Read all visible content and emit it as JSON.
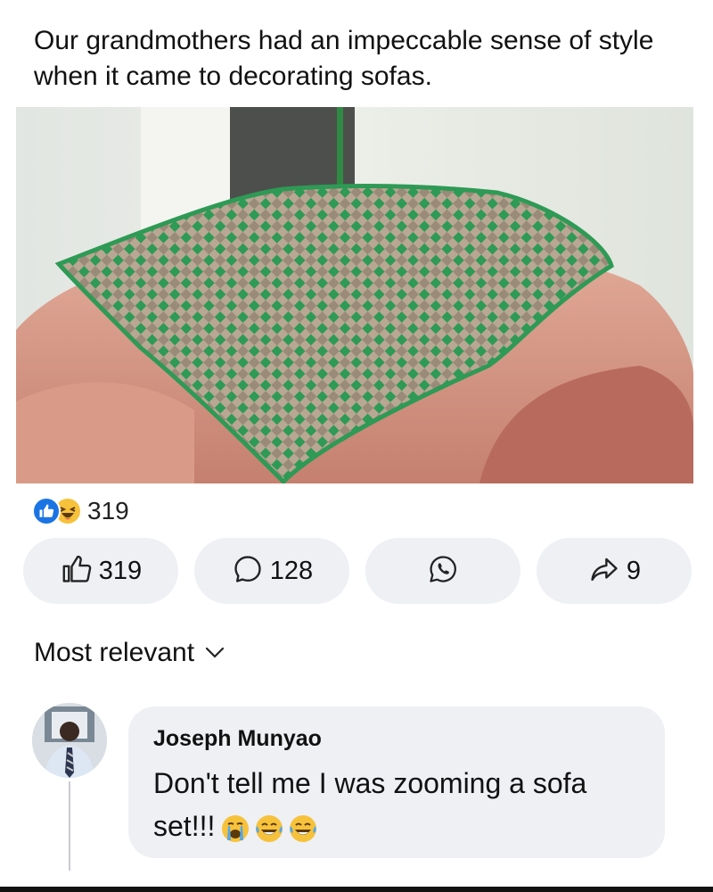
{
  "post": {
    "caption": "Our grandmothers had an impeccable sense of style when it came to decorating sofas.",
    "photo_icon": "photo-crocheted-cover-on-pink-sofa"
  },
  "reactions": {
    "icons": [
      "like-icon",
      "haha-icon"
    ],
    "total": "319"
  },
  "actions": {
    "like_count": "319",
    "comment_count": "128",
    "whatsapp_icon": "whatsapp-icon",
    "share_count": "9"
  },
  "comments": {
    "sort_label": "Most relevant",
    "items": [
      {
        "author": "Joseph Munyao",
        "text": "Don't tell me I was zooming a sofa set!!!",
        "emojis": [
          "crying-face-icon",
          "tears-of-joy-icon",
          "tears-of-joy-icon"
        ]
      }
    ]
  },
  "colors": {
    "accent": "#1b74e4",
    "button_bg": "#eef0f4",
    "haha": "#f7c23b",
    "crochet_green": "#2e9a55",
    "crochet_beige": "#b8a793",
    "sofa_pink": "#d49685"
  }
}
